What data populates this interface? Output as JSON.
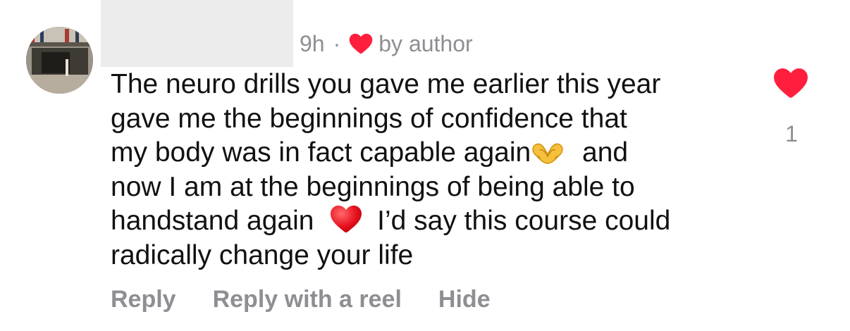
{
  "comment": {
    "time": "9h",
    "separator": "·",
    "liked_by_label": "by author",
    "lines": [
      "The neuro drills you gave me earlier this year",
      "gave me the beginnings of confidence that",
      "my body was in fact capable again",
      "and",
      "now I am at the beginnings of being able to",
      "handstand again",
      "I’d say this course could",
      "radically change your life"
    ],
    "emojis": [
      "heart-hands-emoji",
      "red-heart-emoji"
    ],
    "like_count": "1"
  },
  "actions": {
    "reply": "Reply",
    "reply_with_reel": "Reply with a reel",
    "hide": "Hide"
  },
  "colors": {
    "like_red": "#ff1f3d",
    "meta_gray": "#8e8e93",
    "text": "#111111",
    "redaction": "#ececec"
  }
}
